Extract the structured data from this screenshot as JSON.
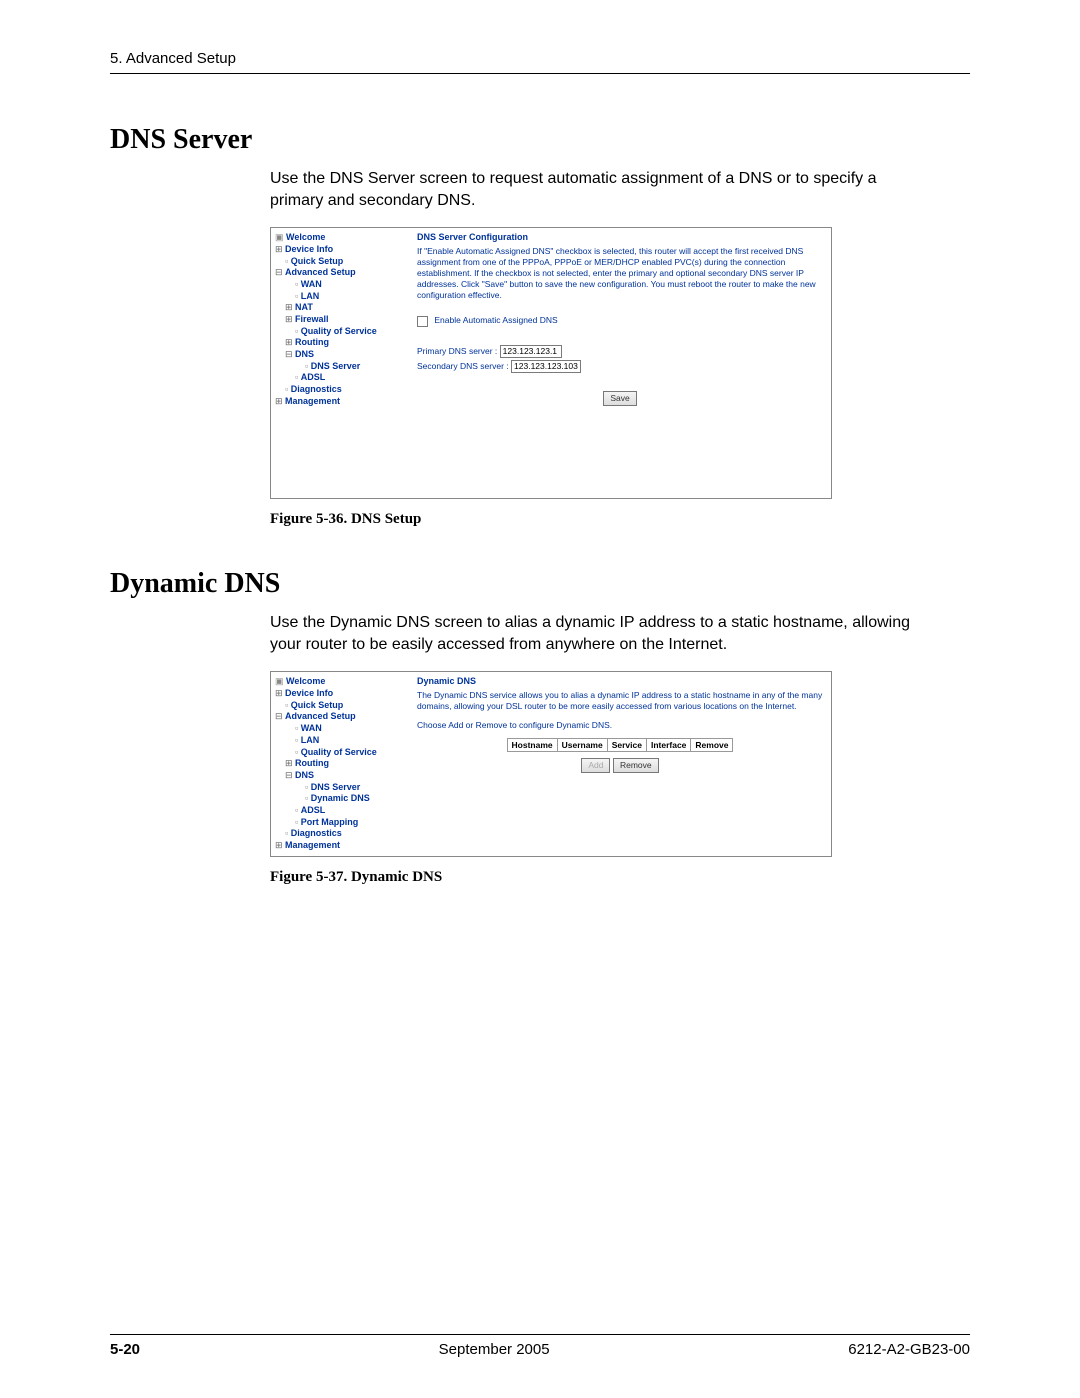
{
  "header": {
    "chapter": "5. Advanced Setup"
  },
  "section1": {
    "title": "DNS Server",
    "body": "Use the DNS Server screen to request automatic assignment of a DNS or to specify a primary and secondary DNS.",
    "figcap": "Figure 5-36.    DNS Setup"
  },
  "section2": {
    "title": "Dynamic DNS",
    "body": "Use the Dynamic DNS screen to alias a dynamic IP address to a static hostname, allowing your router to be easily accessed from anywhere on the Internet.",
    "figcap": "Figure 5-37.    Dynamic DNS"
  },
  "fig1": {
    "nav": {
      "welcome": "Welcome",
      "deviceinfo": "Device Info",
      "quicksetup": "Quick Setup",
      "advsetup": "Advanced Setup",
      "wan": "WAN",
      "lan": "LAN",
      "nat": "NAT",
      "firewall": "Firewall",
      "qos": "Quality of Service",
      "routing": "Routing",
      "dns": "DNS",
      "dnsserver": "DNS Server",
      "adsl": "ADSL",
      "diagnostics": "Diagnostics",
      "management": "Management"
    },
    "main": {
      "title": "DNS Server Configuration",
      "text": "If \"Enable Automatic Assigned DNS\" checkbox is selected, this router will accept the first received DNS assignment from one of the PPPoA, PPPoE or MER/DHCP enabled PVC(s) during the connection establishment. If the checkbox is not selected, enter the primary and optional secondary DNS server IP addresses. Click \"Save\" button to save the new configuration. You must reboot the router to make the new configuration effective.",
      "checkbox_label": "Enable Automatic Assigned DNS",
      "primary_label": "Primary DNS server :",
      "primary_value": "123.123.123.1",
      "secondary_label": "Secondary DNS server :",
      "secondary_value": "123.123.123.103",
      "save_btn": "Save"
    }
  },
  "fig2": {
    "nav": {
      "welcome": "Welcome",
      "deviceinfo": "Device Info",
      "quicksetup": "Quick Setup",
      "advsetup": "Advanced Setup",
      "wan": "WAN",
      "lan": "LAN",
      "qos": "Quality of Service",
      "routing": "Routing",
      "dns": "DNS",
      "dnsserver": "DNS Server",
      "dyndns": "Dynamic DNS",
      "adsl": "ADSL",
      "portmap": "Port Mapping",
      "diagnostics": "Diagnostics",
      "management": "Management"
    },
    "main": {
      "title": "Dynamic DNS",
      "text": "The Dynamic DNS service allows you to alias a dynamic IP address to a static hostname in any of the many domains, allowing your DSL router to be more easily accessed from various locations on the Internet.",
      "choose": "Choose Add or Remove to configure Dynamic DNS.",
      "cols": {
        "hostname": "Hostname",
        "username": "Username",
        "service": "Service",
        "interface": "Interface",
        "remove": "Remove"
      },
      "add_btn": "Add",
      "remove_btn": "Remove"
    }
  },
  "footer": {
    "page": "5-20",
    "date": "September 2005",
    "doc": "6212-A2-GB23-00"
  }
}
